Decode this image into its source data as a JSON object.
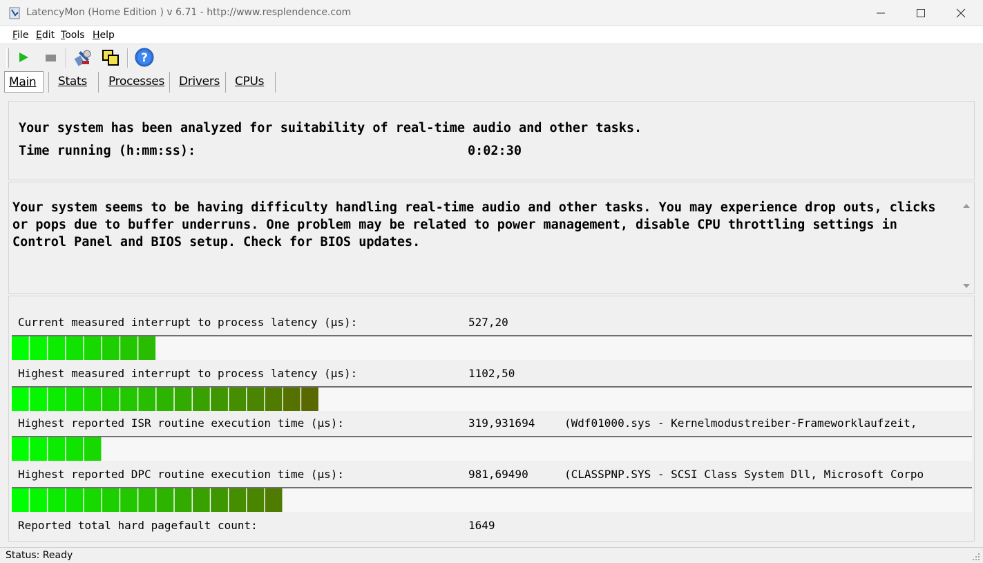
{
  "window": {
    "title": "LatencyMon  (Home Edition )  v 6.71 - http://www.resplendence.com"
  },
  "menu": {
    "file": {
      "access": "F",
      "rest": "ile"
    },
    "edit": {
      "access": "E",
      "rest": "dit"
    },
    "tools": {
      "access": "T",
      "rest": "ools"
    },
    "help": {
      "access": "H",
      "rest": "elp"
    }
  },
  "toolbar": {
    "icons": [
      "play-icon",
      "stop-icon",
      "tools-icon",
      "windows-icon",
      "help-icon"
    ]
  },
  "tabs": [
    {
      "label": "Main"
    },
    {
      "label": "Stats"
    },
    {
      "label": "Processes"
    },
    {
      "label": "Drivers"
    },
    {
      "label": "CPUs"
    }
  ],
  "summary": {
    "analyzed": "Your system has been analyzed for suitability of real-time audio and other tasks.",
    "time_label": "Time running (h:mm:ss):",
    "time_value": "0:02:30"
  },
  "message": "Your system seems to be having difficulty handling real-time audio and other tasks. You may experience drop outs, clicks or pops due to buffer underruns. One problem may be related to power management, disable CPU throttling settings in Control Panel and BIOS setup. Check for BIOS updates.",
  "stats": [
    {
      "label": "Current measured interrupt to process latency (µs):",
      "value": "527,20",
      "extra": "",
      "level_segments": 8
    },
    {
      "label": "Highest measured interrupt to process latency (µs):",
      "value": "1102,50",
      "extra": "",
      "level_segments": 17
    },
    {
      "label": "Highest reported ISR routine execution time (µs):",
      "value": "319,931694",
      "extra": "(Wdf01000.sys - Kernelmodustreiber-Frameworklaufzeit,",
      "level_segments": 5
    },
    {
      "label": "Highest reported DPC routine execution time (µs):",
      "value": "981,69490",
      "extra": "(CLASSPNP.SYS - SCSI Class System Dll, Microsoft Corpo",
      "level_segments": 15
    },
    {
      "label": "Reported total hard pagefault count:",
      "value": "1649",
      "extra": ""
    }
  ],
  "status": "Status: Ready"
}
